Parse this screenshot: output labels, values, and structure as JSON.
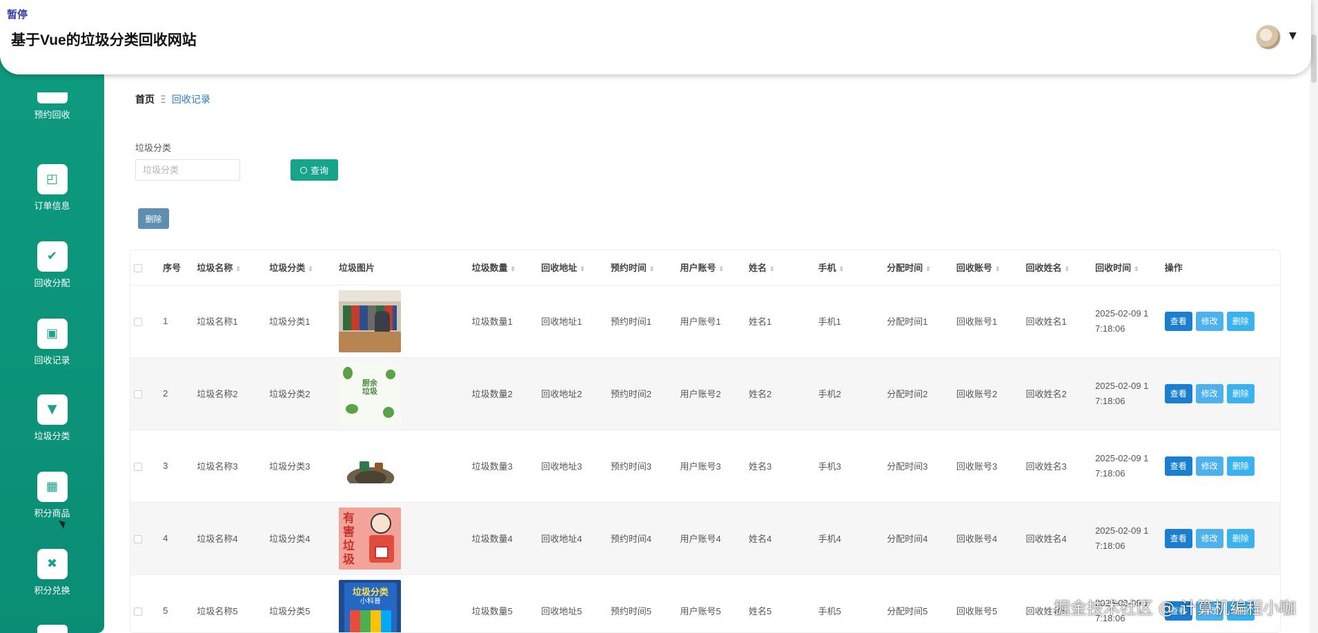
{
  "header": {
    "pause_tag": "暂停",
    "title": "基于Vue的垃圾分类回收网站",
    "caret": "▼"
  },
  "sidebar": {
    "items": [
      {
        "label": "预约回收",
        "icon": "calendar-icon",
        "glyph": "▤"
      },
      {
        "label": "订单信息",
        "icon": "chart-icon",
        "glyph": "◰"
      },
      {
        "label": "回收分配",
        "icon": "clipboard-icon",
        "glyph": "✔"
      },
      {
        "label": "回收记录",
        "icon": "briefcase-icon",
        "glyph": "▣"
      },
      {
        "label": "垃圾分类",
        "icon": "brush-icon",
        "glyph": "▼"
      },
      {
        "label": "积分商品",
        "icon": "grid-icon",
        "glyph": "▦"
      },
      {
        "label": "积分兑换",
        "icon": "exchange-icon",
        "glyph": "✖"
      }
    ]
  },
  "breadcrumb": {
    "home": "首页",
    "separator": "Ξ",
    "current": "回收记录"
  },
  "filter": {
    "label": "垃圾分类",
    "placeholder": "垃圾分类",
    "search_label": "查询",
    "delete_label": "删除"
  },
  "table": {
    "headers": [
      "序号",
      "垃圾名称",
      "垃圾分类",
      "垃圾图片",
      "垃圾数量",
      "回收地址",
      "预约时间",
      "用户账号",
      "姓名",
      "手机",
      "分配时间",
      "回收账号",
      "回收姓名",
      "回收时间",
      "操作"
    ],
    "sort_glyph": "⇕",
    "rows": [
      {
        "no": "1",
        "name": "垃圾名称1",
        "category": "垃圾分类1",
        "image": "recycling-bins-photo",
        "quantity": "垃圾数量1",
        "address": "回收地址1",
        "appt": "预约时间1",
        "user": "用户账号1",
        "person": "姓名1",
        "phone": "手机1",
        "assign": "分配时间1",
        "rec_acct": "回收账号1",
        "rec_name": "回收姓名1",
        "rec_time_1": "2025-02-09 1",
        "rec_time_2": "7:18:06"
      },
      {
        "no": "2",
        "name": "垃圾名称2",
        "category": "垃圾分类2",
        "image": "kitchen-waste-illustration",
        "quantity": "垃圾数量2",
        "address": "回收地址2",
        "appt": "预约时间2",
        "user": "用户账号2",
        "person": "姓名2",
        "phone": "手机2",
        "assign": "分配时间2",
        "rec_acct": "回收账号2",
        "rec_name": "回收姓名2",
        "rec_time_1": "2025-02-09 1",
        "rec_time_2": "7:18:06"
      },
      {
        "no": "3",
        "name": "垃圾名称3",
        "category": "垃圾分类3",
        "image": "trash-pile-photo",
        "quantity": "垃圾数量3",
        "address": "回收地址3",
        "appt": "预约时间3",
        "user": "用户账号3",
        "person": "姓名3",
        "phone": "手机3",
        "assign": "分配时间3",
        "rec_acct": "回收账号3",
        "rec_name": "回收姓名3",
        "rec_time_1": "2025-02-09 1",
        "rec_time_2": "7:18:06"
      },
      {
        "no": "4",
        "name": "垃圾名称4",
        "category": "垃圾分类4",
        "image": "hazardous-waste-poster",
        "quantity": "垃圾数量4",
        "address": "回收地址4",
        "appt": "预约时间4",
        "user": "用户账号4",
        "person": "姓名4",
        "phone": "手机4",
        "assign": "分配时间4",
        "rec_acct": "回收账号4",
        "rec_name": "回收姓名4",
        "rec_time_1": "2025-02-09 1",
        "rec_time_2": "7:18:06"
      },
      {
        "no": "5",
        "name": "垃圾名称5",
        "category": "垃圾分类5",
        "image": "sorting-book-cover",
        "quantity": "垃圾数量5",
        "address": "回收地址5",
        "appt": "预约时间5",
        "user": "用户账号5",
        "person": "姓名5",
        "phone": "手机5",
        "assign": "分配时间5",
        "rec_acct": "回收账号5",
        "rec_name": "回收姓名5",
        "rec_time_1": "2025-02-09 1",
        "rec_time_2": "7:18:06"
      }
    ],
    "actions": {
      "view": "查看",
      "edit": "修改",
      "delete": "删除"
    },
    "thumb_text": {
      "kitchen": "厨余垃圾",
      "hazard": "有害垃圾",
      "book_title": "垃圾分类",
      "book_sub": "小科普"
    }
  },
  "watermark": "掘金技术社区 @ 计算机编程小咖",
  "colors": {
    "accent": "#16a58a",
    "sidebar": "#0d9b7f",
    "view_button": "#1a7fd0",
    "edit_button": "#4db1ee",
    "delete_button": "#3ab2f0",
    "bulk_delete": "#5f8fb0"
  }
}
